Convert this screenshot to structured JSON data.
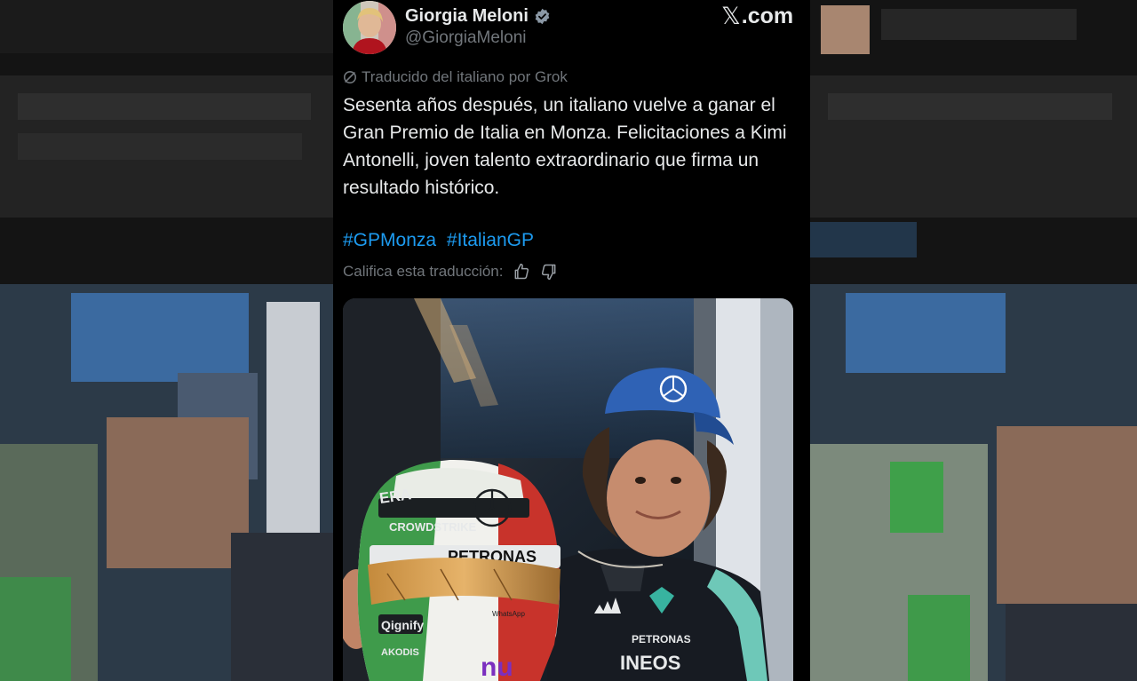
{
  "author": {
    "name": "Giorgia Meloni",
    "handle": "@GiorgiaMeloni",
    "verified_icon": "verified-badge-icon"
  },
  "brand": {
    "logo_text": ".com",
    "logo_icon": "x-logo-icon"
  },
  "translation": {
    "notice": "Traducido del italiano por Grok",
    "rate_prompt": "Califica esta traducción:"
  },
  "tweet": {
    "text": "Sesenta años después, un italiano vuelve a ganar el Gran Premio de Italia en Monza. Felicitaciones a Kimi Antonelli, joven talento extraordinario que firma un resultado histórico.",
    "hashtags": [
      "#GPMonza",
      "#ItalianGP"
    ]
  },
  "media": {
    "helmet_text": {
      "sponsor1": "ERA",
      "sponsor2": "CROWDSTRIKE",
      "sponsor3": "PETRONAS",
      "sponsor4": "Qignify",
      "sponsor5": "AKODIS",
      "sponsor6": "nu",
      "sponsor7": "WhatsApp"
    },
    "shirt_text": {
      "brand1": "PETRONAS",
      "brand2": "INEOS"
    }
  },
  "colors": {
    "link": "#1d9bf0",
    "text": "#e7e9ea",
    "secondary": "#71767b",
    "background": "#000000"
  }
}
